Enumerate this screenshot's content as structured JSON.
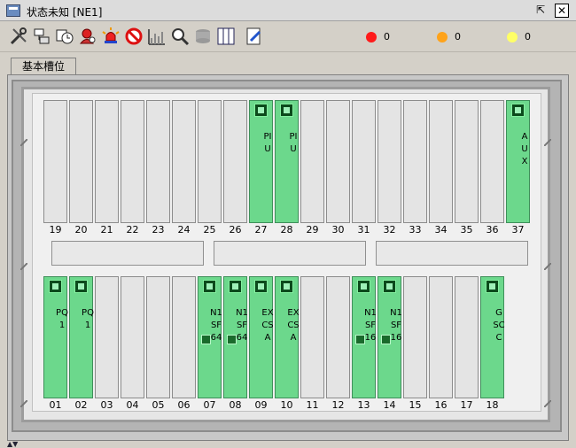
{
  "window": {
    "title": "状态未知 [NE1]",
    "restore_symbol": "⇱",
    "close_symbol": "✕"
  },
  "toolbar": {
    "tools": [
      "tools-icon",
      "device-icon",
      "clock-icon",
      "alarm-user-icon",
      "siren-icon",
      "forbidden-icon",
      "chart-icon",
      "magnify-icon",
      "database-icon",
      "columns-icon",
      "edit-icon"
    ],
    "alarms": [
      {
        "name": "critical",
        "color": "#ff1a1a",
        "count": "0"
      },
      {
        "name": "major",
        "color": "#ffa31a",
        "count": "0"
      },
      {
        "name": "minor",
        "color": "#ffff66",
        "count": "0"
      }
    ]
  },
  "tab": {
    "label": "基本槽位"
  },
  "rack": {
    "top_slots": [
      {
        "num": "19",
        "label": ""
      },
      {
        "num": "20",
        "label": ""
      },
      {
        "num": "21",
        "label": ""
      },
      {
        "num": "22",
        "label": ""
      },
      {
        "num": "23",
        "label": ""
      },
      {
        "num": "24",
        "label": ""
      },
      {
        "num": "25",
        "label": ""
      },
      {
        "num": "26",
        "label": ""
      },
      {
        "num": "27",
        "label": "PIU"
      },
      {
        "num": "28",
        "label": "PIU"
      },
      {
        "num": "29",
        "label": ""
      },
      {
        "num": "30",
        "label": ""
      },
      {
        "num": "31",
        "label": ""
      },
      {
        "num": "32",
        "label": ""
      },
      {
        "num": "33",
        "label": ""
      },
      {
        "num": "34",
        "label": ""
      },
      {
        "num": "35",
        "label": ""
      },
      {
        "num": "36",
        "label": ""
      },
      {
        "num": "37",
        "label": "AUX"
      }
    ],
    "bottom_slots": [
      {
        "num": "01",
        "label": "PQ1"
      },
      {
        "num": "02",
        "label": "PQ1"
      },
      {
        "num": "03",
        "label": ""
      },
      {
        "num": "04",
        "label": ""
      },
      {
        "num": "05",
        "label": ""
      },
      {
        "num": "06",
        "label": ""
      },
      {
        "num": "07",
        "label": "N1SF64"
      },
      {
        "num": "08",
        "label": "N1SF64"
      },
      {
        "num": "09",
        "label": "EXCSA"
      },
      {
        "num": "10",
        "label": "EXCSA"
      },
      {
        "num": "11",
        "label": ""
      },
      {
        "num": "12",
        "label": ""
      },
      {
        "num": "13",
        "label": "N1SF16"
      },
      {
        "num": "14",
        "label": "N1SF16"
      },
      {
        "num": "15",
        "label": ""
      },
      {
        "num": "16",
        "label": ""
      },
      {
        "num": "17",
        "label": ""
      },
      {
        "num": "18",
        "label": "GSCC"
      }
    ]
  }
}
